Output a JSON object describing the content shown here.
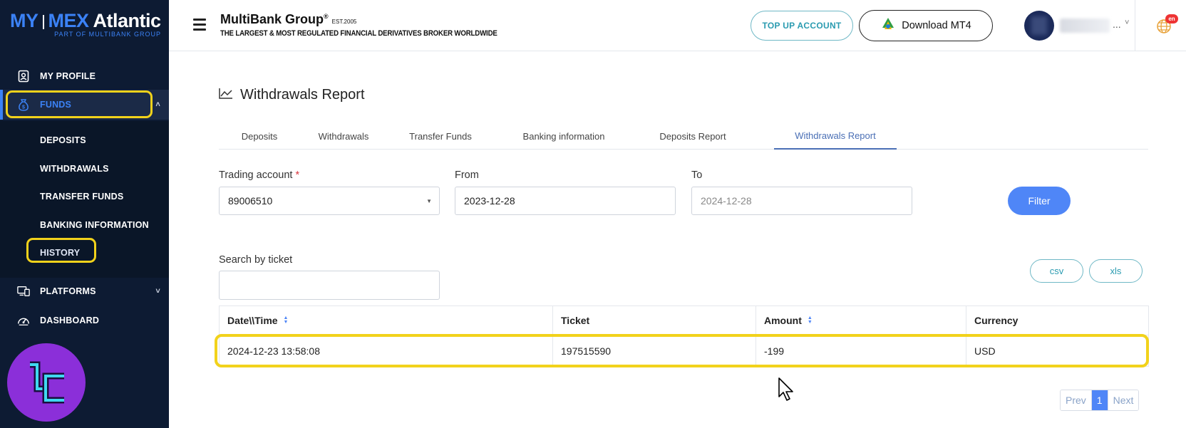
{
  "brand": {
    "logo_part1": "MY",
    "logo_part2": "MEX",
    "logo_part3": "Atlantic",
    "logo_sub": "PART OF MULTIBANK GROUP"
  },
  "sidebar": {
    "items": [
      {
        "label": "MY PROFILE",
        "icon": "profile-icon"
      },
      {
        "label": "FUNDS",
        "icon": "money-bag-icon"
      },
      {
        "label": "PLATFORMS",
        "icon": "monitor-icon"
      },
      {
        "label": "DASHBOARD",
        "icon": "gauge-icon"
      }
    ],
    "funds_sub": [
      "DEPOSITS",
      "WITHDRAWALS",
      "TRANSFER FUNDS",
      "BANKING INFORMATION",
      "HISTORY"
    ]
  },
  "header": {
    "title": "MultiBank Group",
    "title_mark": "®",
    "est": "EST.2005",
    "subtitle": "THE LARGEST & MOST REGULATED FINANCIAL DERIVATIVES BROKER WORLDWIDE",
    "topup_label": "TOP UP ACCOUNT",
    "mt4_label": "Download MT4",
    "user_dots": "...",
    "lang_badge": "en"
  },
  "page": {
    "title": "Withdrawals Report",
    "tabs": [
      "Deposits",
      "Withdrawals",
      "Transfer Funds",
      "Banking information",
      "Deposits Report",
      "Withdrawals Report"
    ],
    "active_tab": "Withdrawals Report"
  },
  "filters": {
    "account_label": "Trading account",
    "account_required": "*",
    "account_value": "89006510",
    "from_label": "From",
    "from_value": "2023-12-28",
    "to_label": "To",
    "to_value": "2024-12-28",
    "filter_label": "Filter",
    "search_label": "Search by ticket",
    "search_value": "",
    "csv_label": "csv",
    "xls_label": "xls"
  },
  "table": {
    "headers": [
      "Date\\\\Time",
      "Ticket",
      "Amount",
      "Currency"
    ],
    "rows": [
      [
        "2024-12-23 13:58:08",
        "197515590",
        "-199",
        "USD"
      ]
    ]
  },
  "pagination": {
    "prev": "Prev",
    "current": "1",
    "next": "Next"
  },
  "colors": {
    "sidebar_bg": "#0d1b33",
    "accent_blue": "#4f86f7",
    "highlight_yellow": "#f2d21b",
    "teal": "#2a9bb0"
  }
}
